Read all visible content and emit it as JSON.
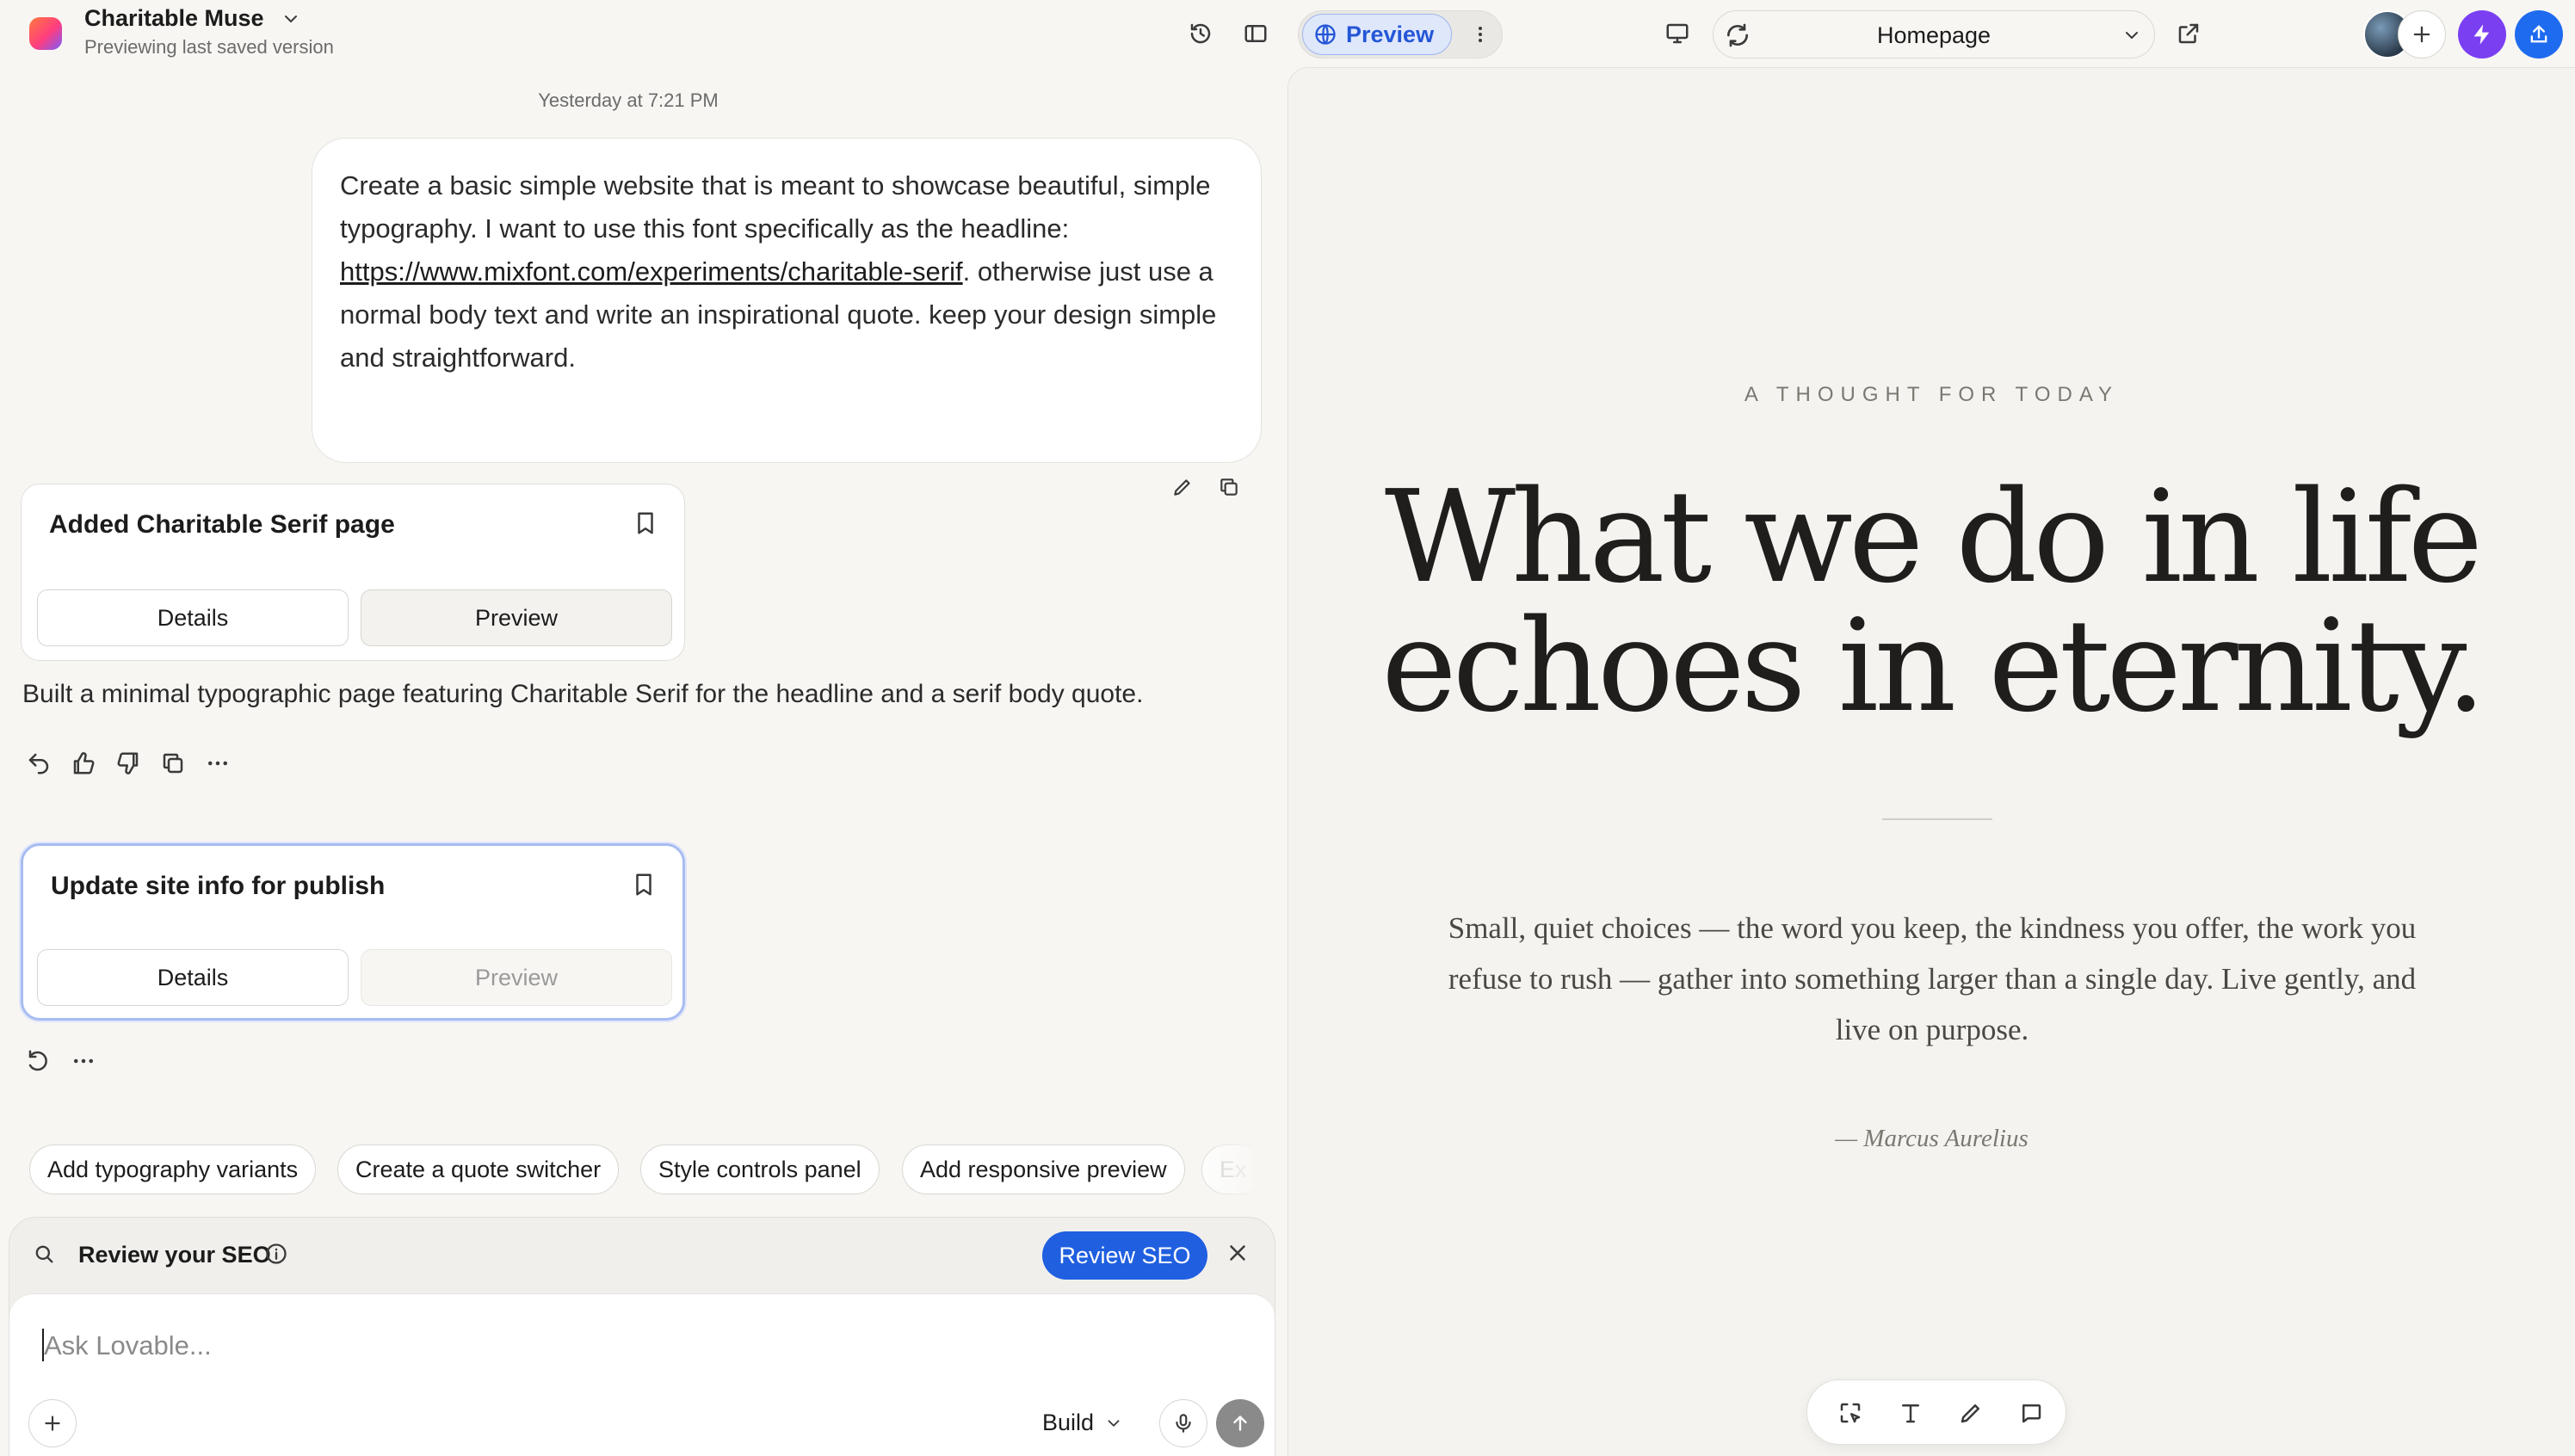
{
  "app": {
    "project_name": "Charitable Muse",
    "project_status": "Previewing last saved version"
  },
  "toolbar": {
    "preview_label": "Preview",
    "page_select": "Homepage"
  },
  "chat": {
    "timestamp": "Yesterday at 7:21 PM",
    "user_message": {
      "text_before": "Create a basic simple website that is meant to showcase beautiful, simple typography. I want to use this font specifically as the headline: ",
      "link": "https://www.mixfont.com/experiments/charitable-serif",
      "text_after": ". otherwise just use a normal body text and write an inspirational quote. keep your design simple and straightforward."
    },
    "card1": {
      "title": "Added Charitable Serif page",
      "details_label": "Details",
      "preview_label": "Preview"
    },
    "assistant_text": "Built a minimal typographic page featuring Charitable Serif for the headline and a serif body quote.",
    "card2": {
      "title": "Update site info for publish",
      "details_label": "Details",
      "preview_label": "Preview"
    },
    "suggestions": [
      "Add typography variants",
      "Create a quote switcher",
      "Style controls panel",
      "Add responsive preview",
      "Ex"
    ]
  },
  "composer": {
    "seo_label": "Review your SEO",
    "seo_button": "Review SEO",
    "placeholder": "Ask Lovable...",
    "mode": "Build"
  },
  "preview": {
    "eyebrow": "A THOUGHT FOR TODAY",
    "headline_line1": "What we do in life",
    "headline_line2": "echoes in eternity.",
    "quote": "Small, quiet choices — the word you keep, the kindness you offer, the work you refuse to rush — gather into something larger than a single day. Live gently, and live on purpose.",
    "author": "— Marcus Aurelius"
  },
  "colors": {
    "accent_blue": "#1f5fe0",
    "bolt_purple": "#7b3ff2",
    "preview_bg": "#f4f3ef"
  }
}
